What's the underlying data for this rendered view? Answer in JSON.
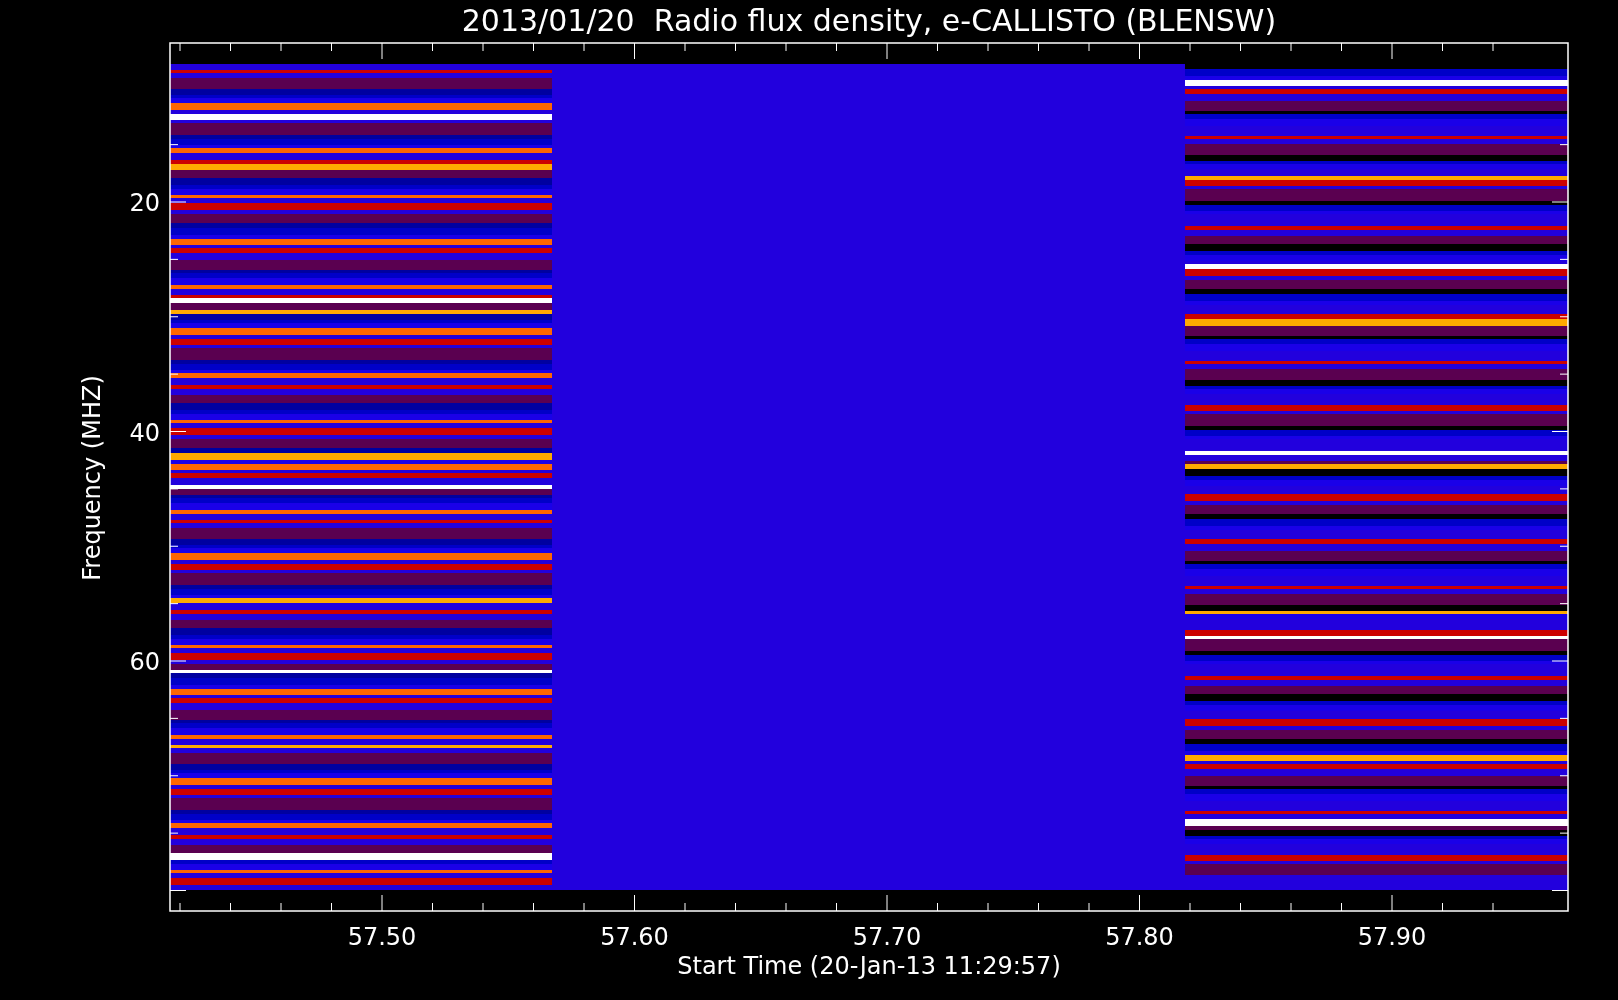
{
  "title": "2013/01/20  Radio flux density, e-CALLISTO (BLENSW)",
  "plot": {
    "ylabel": "Frequency (MHZ)",
    "xlabel": "Start Time (20-Jan-13 11:29:57)",
    "yticks": [
      "20",
      "40",
      "60"
    ],
    "xticks": [
      "57.50",
      "57.60",
      "57.70",
      "57.80",
      "57.90"
    ]
  }
}
